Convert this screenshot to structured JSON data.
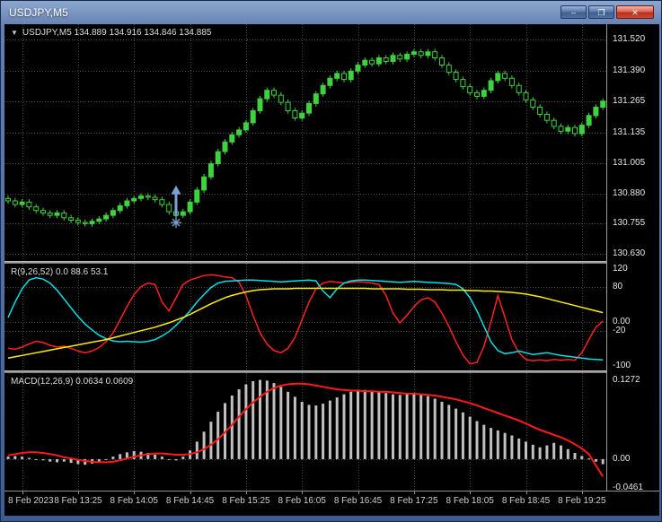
{
  "window": {
    "title": "USDJPY,M5",
    "minimize_glyph": "–",
    "maximize_glyph": "❐",
    "close_glyph": "✕"
  },
  "panels": {
    "price_label_icon": "▼",
    "price_label": "USDJPY,M5 134.889 134.916 134.846 134.885",
    "oscillator_label": "R(9,26,52) 0.0 88.6 53.1",
    "macd_label": "MACD(12,26,9) 0.0634 0.0609"
  },
  "colors": {
    "candle": "#3ed23e",
    "bull_fill": "#3ed23e",
    "bear_fill": "#000000",
    "grid": "#474747",
    "marker": "#7aa3d4"
  },
  "time_axis": {
    "labels": [
      {
        "text": "8 Feb 2023",
        "bar": 2
      },
      {
        "text": "8 Feb 13:25",
        "bar": 10
      },
      {
        "text": "8 Feb 14:05",
        "bar": 18
      },
      {
        "text": "8 Feb 14:45",
        "bar": 26
      },
      {
        "text": "8 Feb 15:25",
        "bar": 34
      },
      {
        "text": "8 Feb 16:05",
        "bar": 42
      },
      {
        "text": "8 Feb 16:45",
        "bar": 50
      },
      {
        "text": "8 Feb 17:25",
        "bar": 58
      },
      {
        "text": "8 Feb 18:05",
        "bar": 66
      },
      {
        "text": "8 Feb 18:45",
        "bar": 74
      },
      {
        "text": "8 Feb 19:25",
        "bar": 82
      }
    ]
  },
  "chart_data": [
    {
      "id": "price",
      "type": "candlestick",
      "symbol": "USDJPY",
      "timeframe": "M5",
      "title": "USDJPY,M5 134.889 134.916 134.846 134.885",
      "ohlc_display": {
        "open": "134.889",
        "high": "134.916",
        "low": "134.846",
        "close": "134.885"
      },
      "ylim": [
        130.6,
        131.585
      ],
      "y_ticks": [
        {
          "label": "131.520",
          "value": 131.52
        },
        {
          "label": "131.390",
          "value": 131.39
        },
        {
          "label": "131.265",
          "value": 131.265
        },
        {
          "label": "131.135",
          "value": 131.135
        },
        {
          "label": "131.005",
          "value": 131.005
        },
        {
          "label": "130.880",
          "value": 130.88
        },
        {
          "label": "130.755",
          "value": 130.755
        },
        {
          "label": "130.630",
          "value": 130.63
        }
      ],
      "grid_values": [
        131.52,
        131.39,
        131.265,
        131.135,
        131.005,
        130.88,
        130.755,
        130.63
      ],
      "first_open": 130.86,
      "wick_extra": 0.012,
      "closes": [
        130.85,
        130.835,
        130.845,
        130.825,
        130.81,
        130.8,
        130.79,
        130.8,
        130.78,
        130.77,
        130.76,
        130.755,
        130.765,
        130.775,
        130.79,
        130.81,
        130.83,
        130.85,
        130.86,
        130.87,
        130.865,
        130.855,
        130.835,
        130.805,
        130.79,
        130.805,
        130.845,
        130.895,
        130.95,
        131.005,
        131.055,
        131.095,
        131.125,
        131.145,
        131.175,
        131.225,
        131.275,
        131.31,
        131.29,
        131.26,
        131.225,
        131.195,
        131.215,
        131.255,
        131.295,
        131.33,
        131.36,
        131.38,
        131.355,
        131.39,
        131.415,
        131.435,
        131.42,
        131.445,
        131.43,
        131.455,
        131.44,
        131.46,
        131.47,
        131.455,
        131.47,
        131.445,
        131.415,
        131.385,
        131.355,
        131.325,
        131.3,
        131.285,
        131.31,
        131.35,
        131.38,
        131.36,
        131.33,
        131.3,
        131.27,
        131.24,
        131.21,
        131.185,
        131.16,
        131.14,
        131.155,
        131.13,
        131.165,
        131.205,
        131.24,
        131.265
      ],
      "marker": {
        "type": "buy-arrow",
        "bar": 24,
        "price_tip": 130.915,
        "price_base": 130.76,
        "color": "#7aa3d4"
      }
    },
    {
      "id": "oscillator",
      "type": "line",
      "title": "R(9,26,52) 0.0 88.6 53.1",
      "ylim": [
        -110,
        132
      ],
      "y_ticks": [
        {
          "label": "120",
          "value": 120
        },
        {
          "label": "80",
          "value": 80
        },
        {
          "label": "0.00",
          "value": 0
        },
        {
          "label": "-20",
          "value": -20
        },
        {
          "label": "-100",
          "value": -100
        }
      ],
      "grid_values": [
        80,
        0,
        -20
      ],
      "series": [
        {
          "name": "fast",
          "color": "#ff2020",
          "values": [
            -60,
            -62,
            -57,
            -50,
            -44,
            -47,
            -53,
            -57,
            -55,
            -60,
            -66,
            -70,
            -66,
            -58,
            -45,
            -25,
            5,
            35,
            62,
            80,
            88,
            85,
            45,
            25,
            55,
            85,
            95,
            100,
            105,
            107,
            105,
            102,
            100,
            90,
            60,
            15,
            -25,
            -50,
            -65,
            -70,
            -60,
            -35,
            5,
            45,
            75,
            88,
            92,
            90,
            88,
            90,
            92,
            90,
            88,
            85,
            60,
            20,
            -2,
            15,
            35,
            50,
            55,
            45,
            20,
            -10,
            -45,
            -75,
            -95,
            -92,
            -55,
            0,
            60,
            10,
            -40,
            -70,
            -85,
            -88,
            -86,
            -88,
            -85,
            -87,
            -85,
            -87,
            -70,
            -40,
            -12,
            2
          ]
        },
        {
          "name": "medium",
          "color": "#00e2e8",
          "values": [
            10,
            45,
            75,
            95,
            100,
            97,
            88,
            72,
            52,
            32,
            12,
            -5,
            -18,
            -30,
            -38,
            -43,
            -45,
            -44,
            -45,
            -46,
            -44,
            -40,
            -32,
            -22,
            -8,
            8,
            25,
            45,
            62,
            78,
            88,
            92,
            93,
            94,
            95,
            95,
            94,
            93,
            92,
            91,
            92,
            93,
            94,
            95,
            93,
            70,
            55,
            75,
            88,
            93,
            95,
            95,
            94,
            93,
            92,
            91,
            90,
            91,
            92,
            91,
            90,
            89,
            88,
            87,
            85,
            75,
            55,
            25,
            -10,
            -45,
            -65,
            -72,
            -70,
            -66,
            -70,
            -74,
            -72,
            -70,
            -73,
            -76,
            -78,
            -80,
            -82,
            -84,
            -85,
            -86
          ]
        },
        {
          "name": "slow",
          "color": "#ffee00",
          "values": [
            -82,
            -79,
            -76,
            -73,
            -70,
            -67,
            -64,
            -61,
            -58,
            -55,
            -52,
            -49,
            -46,
            -43,
            -40,
            -36,
            -32,
            -28,
            -24,
            -20,
            -16,
            -12,
            -7,
            -2,
            4,
            10,
            17,
            25,
            33,
            41,
            48,
            55,
            60,
            64,
            68,
            71,
            73,
            74,
            75,
            75,
            75,
            76,
            76,
            76,
            76,
            76,
            76,
            76,
            76,
            76,
            76,
            76,
            75,
            75,
            75,
            75,
            75,
            74,
            74,
            74,
            73,
            73,
            73,
            72,
            72,
            72,
            71,
            71,
            70,
            70,
            69,
            68,
            67,
            65,
            63,
            60,
            57,
            53,
            49,
            45,
            41,
            37,
            33,
            29,
            25,
            21
          ]
        }
      ]
    },
    {
      "id": "macd",
      "type": "histogram+line",
      "title": "MACD(12,26,9) 0.0634 0.0609",
      "current_values": {
        "macd": "0.0634",
        "signal": "0.0609"
      },
      "ylim": [
        -0.0505,
        0.138
      ],
      "y_ticks": [
        {
          "label": "0.1272",
          "value": 0.1272
        },
        {
          "label": "0.00",
          "value": 0
        },
        {
          "label": "-0.0461",
          "value": -0.0461
        }
      ],
      "grid_values": [
        0
      ],
      "histogram": {
        "name": "MACD",
        "color": "#c0c0c0",
        "values": [
          0.004,
          0.005,
          0.004,
          0.002,
          0.0,
          -0.002,
          -0.004,
          -0.005,
          -0.004,
          -0.006,
          -0.008,
          -0.009,
          -0.007,
          -0.004,
          0.0,
          0.004,
          0.008,
          0.011,
          0.013,
          0.012,
          0.01,
          0.007,
          0.004,
          0.0,
          -0.002,
          0.004,
          0.014,
          0.028,
          0.044,
          0.06,
          0.076,
          0.09,
          0.102,
          0.112,
          0.12,
          0.125,
          0.127,
          0.126,
          0.122,
          0.116,
          0.108,
          0.1,
          0.092,
          0.087,
          0.086,
          0.089,
          0.094,
          0.099,
          0.104,
          0.108,
          0.11,
          0.111,
          0.11,
          0.108,
          0.106,
          0.104,
          0.103,
          0.104,
          0.105,
          0.104,
          0.101,
          0.097,
          0.092,
          0.087,
          0.081,
          0.075,
          0.068,
          0.061,
          0.055,
          0.05,
          0.046,
          0.042,
          0.038,
          0.033,
          0.028,
          0.023,
          0.019,
          0.022,
          0.026,
          0.022,
          0.016,
          0.01,
          0.005,
          0.001,
          -0.004,
          -0.008
        ]
      },
      "signal": {
        "name": "Signal",
        "color": "#ff1a1a",
        "values": [
          0.006,
          0.008,
          0.01,
          0.011,
          0.011,
          0.01,
          0.008,
          0.006,
          0.003,
          0.001,
          -0.001,
          -0.003,
          -0.004,
          -0.005,
          -0.005,
          -0.004,
          -0.002,
          0.001,
          0.004,
          0.006,
          0.008,
          0.009,
          0.009,
          0.008,
          0.007,
          0.007,
          0.008,
          0.011,
          0.016,
          0.023,
          0.032,
          0.043,
          0.055,
          0.068,
          0.08,
          0.091,
          0.1,
          0.108,
          0.114,
          0.118,
          0.12,
          0.121,
          0.121,
          0.12,
          0.118,
          0.116,
          0.114,
          0.112,
          0.111,
          0.11,
          0.11,
          0.109,
          0.109,
          0.108,
          0.108,
          0.107,
          0.106,
          0.105,
          0.105,
          0.104,
          0.103,
          0.102,
          0.1,
          0.098,
          0.096,
          0.093,
          0.09,
          0.086,
          0.082,
          0.078,
          0.074,
          0.07,
          0.066,
          0.062,
          0.057,
          0.052,
          0.047,
          0.043,
          0.039,
          0.035,
          0.03,
          0.024,
          0.017,
          0.008,
          -0.01,
          -0.028
        ]
      }
    }
  ]
}
